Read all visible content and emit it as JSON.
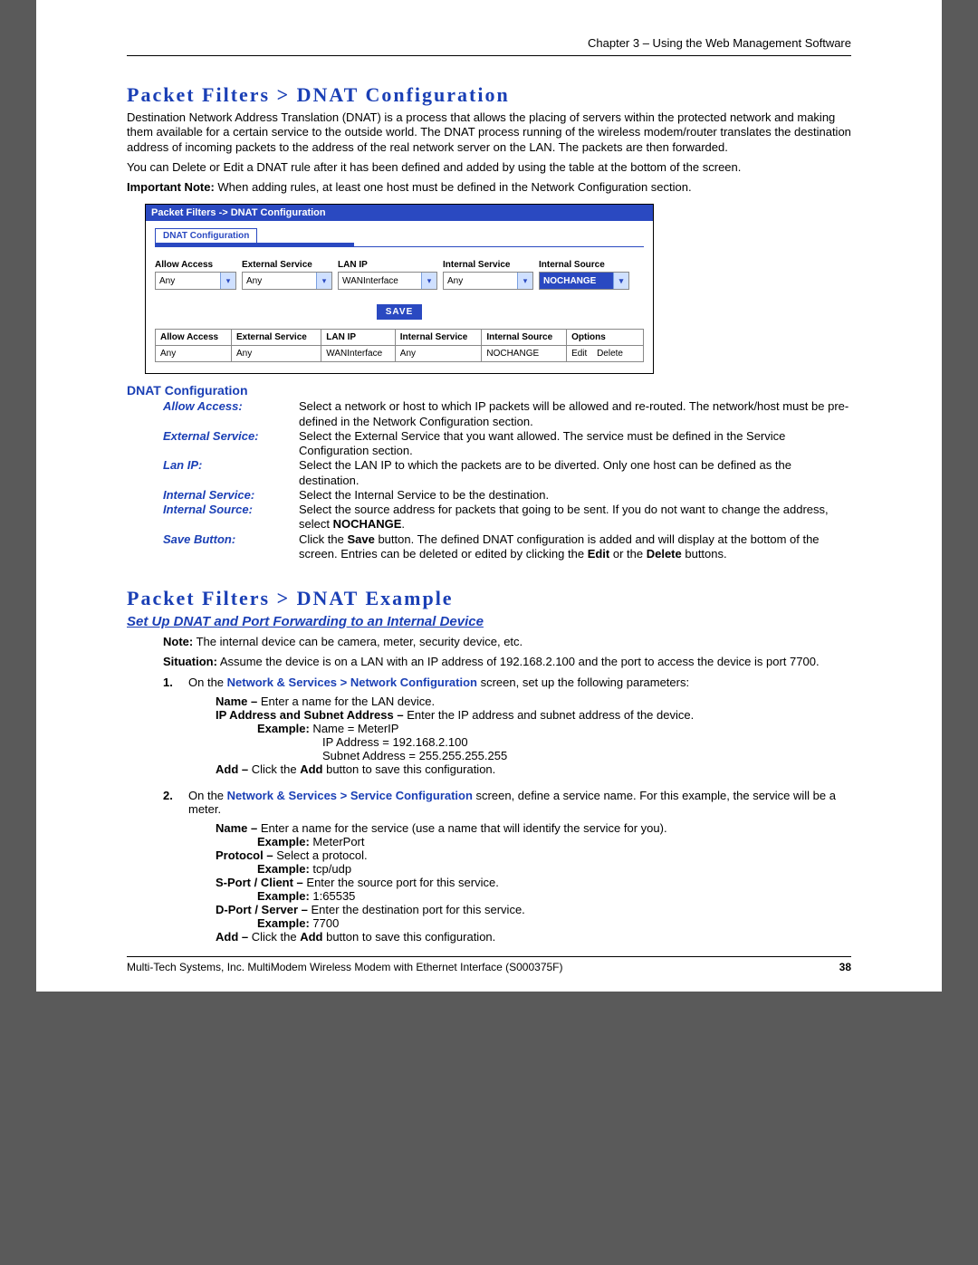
{
  "header": "Chapter 3 – Using the Web Management Software",
  "section1": {
    "title": "Packet Filters > DNAT Configuration",
    "para1": "Destination Network Address Translation (DNAT) is a process that allows the placing of servers within the protected network and making them available for a certain service to the outside world. The DNAT process running of the wireless modem/router translates the destination address of incoming packets to the address of the real network server on the LAN. The packets are then forwarded.",
    "para2": "You can Delete or Edit a DNAT rule after it has been defined and added by using the table at the bottom of the screen.",
    "note_label": "Important Note:",
    "note_text": " When adding rules, at least one host must be defined in the Network Configuration section."
  },
  "app": {
    "title": "Packet Filters  ->  DNAT Configuration",
    "tab": "DNAT Configuration",
    "labels": {
      "allow": "Allow Access",
      "extsvc": "External Service",
      "lanip": "LAN IP",
      "intsvc": "Internal Service",
      "intsrc": "Internal Source"
    },
    "values": {
      "allow": "Any",
      "extsvc": "Any",
      "lanip": "WANInterface",
      "intsvc": "Any",
      "intsrc": "NOCHANGE"
    },
    "save": "SAVE",
    "table": {
      "headers": [
        "Allow Access",
        "External Service",
        "LAN IP",
        "Internal Service",
        "Internal Source",
        "Options"
      ],
      "row": [
        "Any",
        "Any",
        "WANInterface",
        "Any",
        "NOCHANGE"
      ],
      "edit": "Edit",
      "delete": "Delete"
    }
  },
  "defs": {
    "heading": "DNAT Configuration",
    "allow": {
      "t": "Allow Access:",
      "b": "Select a network or host to which IP packets will be allowed and re-routed. The network/host must be pre-defined in the Network Configuration section."
    },
    "ext": {
      "t": "External Service:",
      "b": "Select the External Service that you want allowed. The service must be defined in the Service Configuration section."
    },
    "lan": {
      "t": "Lan IP:",
      "b": "Select the LAN IP to which the packets are to be diverted. Only one host can be defined as the destination."
    },
    "isvc": {
      "t": "Internal Service:",
      "b": "Select the Internal Service to be the destination."
    },
    "isrc": {
      "t": "Internal Source:",
      "b": "Select the source address for packets that going to be sent. If you do not want to change the address, select "
    },
    "isrc_b": "NOCHANGE",
    "save": {
      "t": "Save Button:",
      "b1": "Click the ",
      "save": "Save",
      "b2": " button. The defined DNAT configuration is added and will display at the bottom of the screen. Entries can be deleted or edited by clicking the ",
      "edit": "Edit",
      "b3": " or the ",
      "del": "Delete",
      "b4": " buttons."
    }
  },
  "section2": {
    "title": "Packet Filters > DNAT Example",
    "sub": "Set Up DNAT and Port Forwarding to an Internal Device",
    "note_l": "Note:",
    "note_t": " The internal device can be camera, meter, security device, etc.",
    "sit_l": "Situation:",
    "sit_t": " Assume the device is on a LAN with an IP address of 192.168.2.100 and the port to access the device is port 7700.",
    "step1": {
      "pre": "On the ",
      "link": "Network & Services > Network Configuration",
      "post": " screen, set up the following parameters:",
      "name_l": "Name – ",
      "name_t": "Enter a name for the LAN device.",
      "ip_l": "IP Address and Subnet Address – ",
      "ip_t": "Enter the IP address and subnet address of the device.",
      "ex_l": "Example:",
      "ex1": "  Name = MeterIP",
      "ex2": "IP Address = 192.168.2.100",
      "ex3": "Subnet Address = 255.255.255.255",
      "add_l": "Add – ",
      "add_t1": "Click the ",
      "add_b": "Add",
      "add_t2": " button to save this configuration."
    },
    "step2": {
      "pre": "On the ",
      "link": "Network & Services > Service Configuration",
      "post": " screen, define a service name. For this example, the service will be a meter.",
      "name_l": "Name – ",
      "name_t": "Enter a name for the service (use a name that will identify the service for you).",
      "ex_l": "Example:",
      "ex_name": " MeterPort",
      "proto_l": "Protocol – ",
      "proto_t": "Select a protocol.",
      "ex_proto": "  tcp/udp",
      "sport_l": "S-Port / Client – ",
      "sport_t": "Enter the source port for this service.",
      "ex_sport": "  1:65535",
      "dport_l": "D-Port / Server – ",
      "dport_t": "Enter the destination port for this service.",
      "ex_dport": "  7700",
      "add_l": "Add – ",
      "add_t1": "Click the ",
      "add_b": "Add",
      "add_t2": " button to save this configuration."
    }
  },
  "footer": {
    "text": "Multi-Tech Systems, Inc. MultiModem Wireless Modem with Ethernet Interface (S000375F)",
    "page": "38"
  }
}
